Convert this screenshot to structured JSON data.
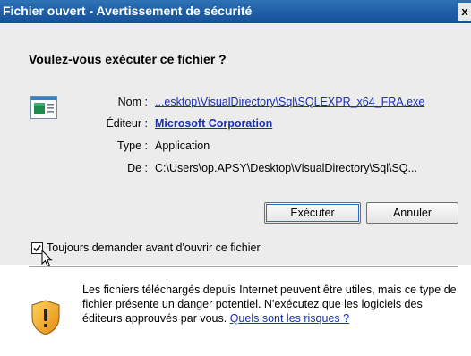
{
  "window": {
    "title": "Fichier ouvert - Avertissement de sécurité",
    "close_glyph": "x"
  },
  "dialog": {
    "question": "Voulez-vous exécuter ce fichier ?",
    "file_icon": "application-window-icon",
    "fields": {
      "name_label": "Nom :",
      "name_value": "...esktop\\VisualDirectory\\Sql\\SQLEXPR_x64_FRA.exe",
      "publisher_label": "Éditeur :",
      "publisher_value": "Microsoft Corporation",
      "type_label": "Type :",
      "type_value": "Application",
      "from_label": "De :",
      "from_value": "C:\\Users\\op.APSY\\Desktop\\VisualDirectory\\Sql\\SQ..."
    },
    "buttons": {
      "run": "Exécuter",
      "cancel": "Annuler"
    },
    "checkbox": {
      "label": "Toujours demander avant d'ouvrir ce fichier",
      "checked": true
    }
  },
  "warning": {
    "icon": "shield-warning-icon",
    "text": "Les fichiers téléchargés depuis Internet peuvent être utiles, mais ce type de fichier présente un danger potentiel. N'exécutez que les logiciels des éditeurs approuvés par vous. ",
    "link": "Quels sont les risques ?"
  },
  "colors": {
    "titlebar": "#1f5fa6",
    "link": "#1a2fb0",
    "panel": "#ececec"
  }
}
